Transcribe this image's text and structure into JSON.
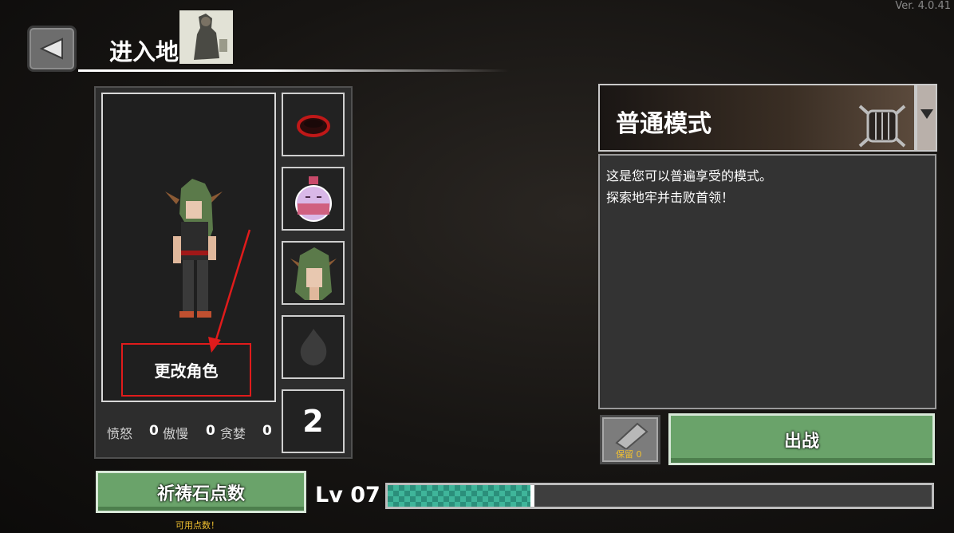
{
  "version": "Ver. 4.0.41",
  "header": {
    "title": "进入地"
  },
  "character": {
    "change_label": "更改角色",
    "equipment_count": "2",
    "sins": [
      {
        "label": "愤怒",
        "value": "0"
      },
      {
        "label": "傲慢",
        "value": "0"
      },
      {
        "label": "贪婪",
        "value": "0"
      }
    ]
  },
  "mode": {
    "title": "普通模式",
    "description_line1": "这是您可以普遍享受的模式。",
    "description_line2": "探索地牢并击败首领！"
  },
  "actions": {
    "keep_label": "保留 0",
    "go_label": "出战",
    "pray_label": "祈祷石点数",
    "pray_note": "可用点数！"
  },
  "level": {
    "label": "Lv 07",
    "progress": 0.27
  },
  "colors": {
    "accent_green": "#6aa36a",
    "annotation_red": "#e01b1b",
    "xp_teal": "#3fb59a",
    "note_yellow": "#f0c030"
  }
}
